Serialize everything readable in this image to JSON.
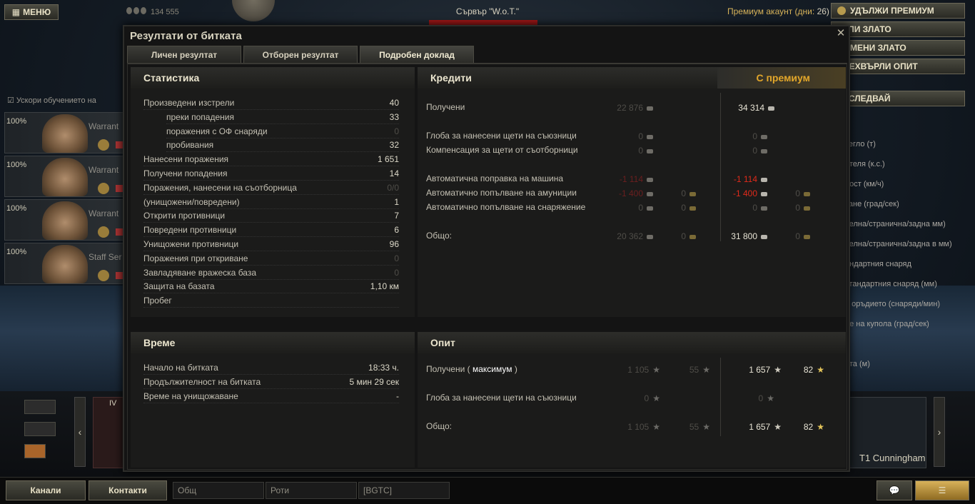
{
  "top": {
    "menu_label": "МЕНЮ",
    "gold_value": "134 555",
    "server_label": "Сървър \"W.o.T.\"",
    "premium_label": "Премиум акаунт (дни:",
    "premium_days": "26)"
  },
  "right_buttons": [
    "УДЪЛЖИ ПРЕМИУМ",
    "КУПИ ЗЛАТО",
    "ОБМЕНИ ЗЛАТО",
    "ПРЕХВЪРЛИ ОПИТ",
    "ИЗСЛЕДВАЙ"
  ],
  "right_stats": [
    "тегло (т)",
    "ателя (к.с.)",
    "рост (км/ч)",
    "тане (град/сек)",
    "челна/странична/задна мм)",
    "челна/странична/задна в мм)",
    "андартния снаряд",
    "стандартния снаряд (мм)",
    "а оръдието (снаряди/мин)",
    "не на купола (град/сек)",
    "ата (м)"
  ],
  "accel_label": "Ускори обучението на",
  "crew": [
    {
      "pct": "100%",
      "rank": "Warrant"
    },
    {
      "pct": "100%",
      "rank": "Warrant"
    },
    {
      "pct": "100%",
      "rank": "Warrant"
    },
    {
      "pct": "100%",
      "rank": "Staff Ser"
    }
  ],
  "dialog": {
    "title": "Резултати от битката",
    "tabs": [
      "Личен резултат",
      "Отборен резултат",
      "Подробен доклад"
    ],
    "stats": {
      "title": "Статистика",
      "rows": [
        {
          "label": "Произведени изстрели",
          "value": "40",
          "dim": false,
          "indent": false
        },
        {
          "label": "преки попадения",
          "value": "33",
          "dim": false,
          "indent": true
        },
        {
          "label": "поражения с ОФ снаряди",
          "value": "0",
          "dim": true,
          "indent": true
        },
        {
          "label": "пробивания",
          "value": "32",
          "dim": false,
          "indent": true
        },
        {
          "label": "Нанесени поражения",
          "value": "1 651",
          "dim": false,
          "indent": false
        },
        {
          "label": "Получени попадения",
          "value": "14",
          "dim": false,
          "indent": false
        },
        {
          "label": "Поражения, нанесени на съотборница",
          "value": "0/0",
          "dim": true,
          "indent": false
        },
        {
          "label": "(унищожени/повредени)",
          "value": "1",
          "dim": false,
          "indent": false
        },
        {
          "label": "Открити противници",
          "value": "7",
          "dim": false,
          "indent": false
        },
        {
          "label": "Повредени противници",
          "value": "6",
          "dim": false,
          "indent": false
        },
        {
          "label": "Унищожени противници",
          "value": "96",
          "dim": false,
          "indent": false
        },
        {
          "label": "Поражения при откриване",
          "value": "0",
          "dim": true,
          "indent": false
        },
        {
          "label": "Завладяване вражеска база",
          "value": "0",
          "dim": true,
          "indent": false
        },
        {
          "label": "Защита на базата",
          "value": "1,10 км",
          "dim": false,
          "indent": false
        },
        {
          "label": "Пробег",
          "value": "",
          "dim": false,
          "indent": false
        }
      ]
    },
    "credits": {
      "title": "Кредити",
      "premium_header": "С премиум",
      "received_label": "Получени",
      "received_base": "22 876",
      "received_prem": "34 314",
      "fine_label": "Глоба за нанесени щети на съюзници",
      "fine_base": "0",
      "fine_prem": "0",
      "comp_label": "Компенсация за щети от съотборници",
      "comp_base": "0",
      "comp_prem": "0",
      "repair_label": "Автоматична поправка на машина",
      "repair_base": "-1 114",
      "repair_prem": "-1 114",
      "ammo_label": "Автоматично попълване на амуниции",
      "ammo_base": "-1 400",
      "ammo_base_gold": "0",
      "ammo_prem": "-1 400",
      "ammo_prem_gold": "0",
      "equip_label": "Автоматично попълване на снаряжение",
      "equip_base": "0",
      "equip_base_gold": "0",
      "equip_prem": "0",
      "equip_prem_gold": "0",
      "total_label": "Общо:",
      "total_base": "20 362",
      "total_base_gold": "0",
      "total_prem": "31 800",
      "total_prem_gold": "0"
    },
    "time": {
      "title": "Време",
      "rows": [
        {
          "label": "Начало на битката",
          "value": "18:33 ч."
        },
        {
          "label": "Продължителност на битката",
          "value": "5 мин 29 сек"
        },
        {
          "label": "Време на унищожаване",
          "value": "-"
        }
      ]
    },
    "xp": {
      "title": "Опит",
      "received_label": "Получени (",
      "received_max": "максимум",
      "received_close": ")",
      "received_base": "1 105",
      "received_base_free": "55",
      "received_prem": "1 657",
      "received_prem_free": "82",
      "fine_label": "Глоба за нанесени щети на съюзници",
      "fine_base": "0",
      "fine_prem": "0",
      "total_label": "Общо:",
      "total_base": "1 105",
      "total_base_free": "55",
      "total_prem": "1 657",
      "total_prem_free": "82"
    }
  },
  "bottom": {
    "channels": "Канали",
    "contacts": "Контакти",
    "field1": "Общ",
    "field2": "Роти",
    "field3": "[BGTC]"
  },
  "tank": {
    "name": "T1 Cunningham",
    "tier": "IV"
  }
}
